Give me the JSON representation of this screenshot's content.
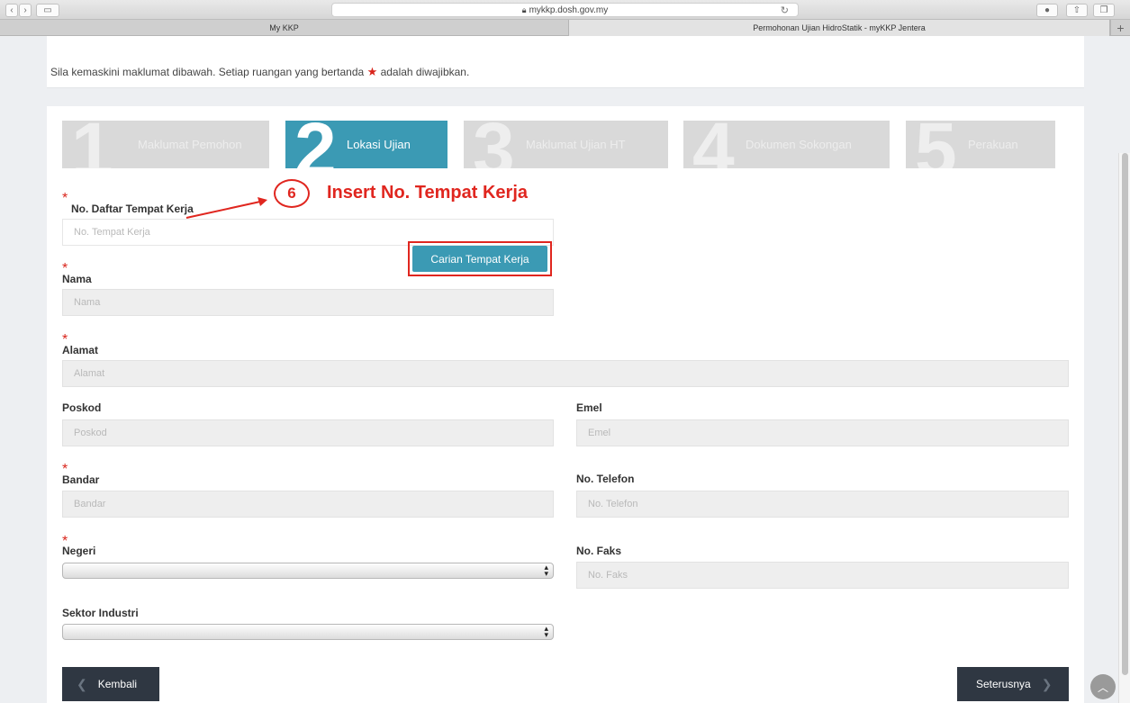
{
  "browser": {
    "url": "mykkp.dosh.gov.my",
    "tabs": [
      {
        "label": "My KKP"
      },
      {
        "label": "Permohonan Ujian HidroStatik - myKKP Jentera"
      }
    ]
  },
  "notice": {
    "before_star": "Sila kemaskini maklumat dibawah. Setiap ruangan yang bertanda",
    "after_star": "adalah diwajibkan."
  },
  "steps": [
    {
      "number": "1",
      "label": "Maklumat Pemohon"
    },
    {
      "number": "2",
      "label": "Lokasi Ujian"
    },
    {
      "number": "3",
      "label": "Maklumat Ujian HT"
    },
    {
      "number": "4",
      "label": "Dokumen Sokongan"
    },
    {
      "number": "5",
      "label": "Perakuan"
    }
  ],
  "annotation": {
    "number": "6",
    "text": "Insert No. Tempat Kerja"
  },
  "form": {
    "required_mark": "*",
    "no_daftar": {
      "label": "No. Daftar Tempat Kerja",
      "placeholder": "No. Tempat Kerja"
    },
    "search_button": "Carian Tempat Kerja",
    "nama": {
      "label": "Nama",
      "placeholder": "Nama"
    },
    "alamat": {
      "label": "Alamat",
      "placeholder": "Alamat"
    },
    "poskod": {
      "label": "Poskod",
      "placeholder": "Poskod"
    },
    "emel": {
      "label": "Emel",
      "placeholder": "Emel"
    },
    "bandar": {
      "label": "Bandar",
      "placeholder": "Bandar"
    },
    "telefon": {
      "label": "No. Telefon",
      "placeholder": "No. Telefon"
    },
    "negeri": {
      "label": "Negeri",
      "value": ""
    },
    "faks": {
      "label": "No. Faks",
      "placeholder": "No. Faks"
    },
    "sektor": {
      "label": "Sektor Industri",
      "value": ""
    }
  },
  "nav": {
    "back": "Kembali",
    "next": "Seterusnya"
  },
  "colors": {
    "accent": "#3b9ab4",
    "annotation": "#e0261f",
    "dark_button": "#2f3742"
  }
}
